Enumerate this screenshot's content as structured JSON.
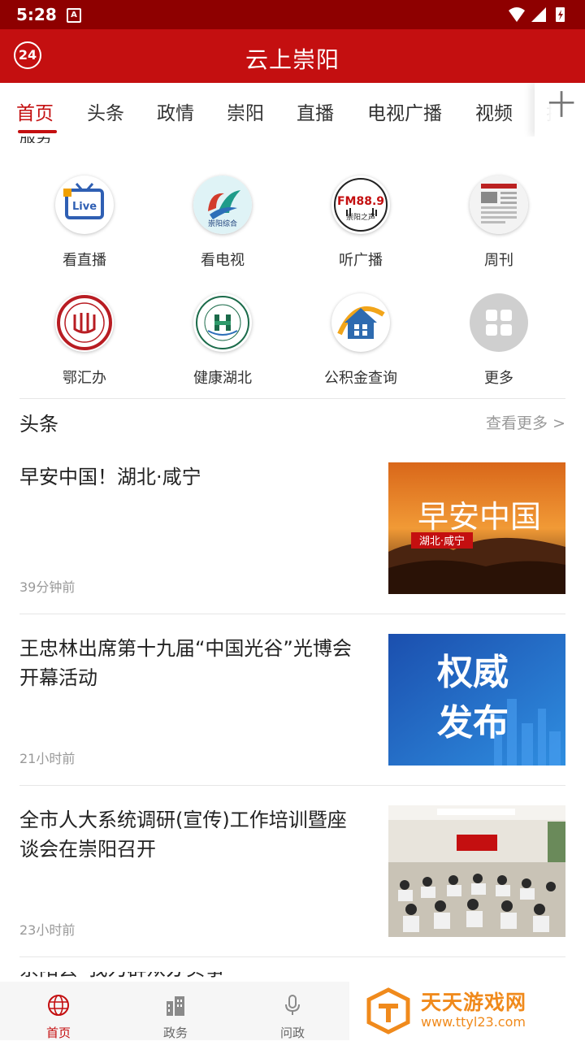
{
  "status_bar": {
    "time": "5:28",
    "notification_glyph": "A"
  },
  "header": {
    "badge": "24",
    "title": "云上崇阳"
  },
  "tabs": [
    {
      "label": "首页",
      "active": true
    },
    {
      "label": "头条"
    },
    {
      "label": "政情"
    },
    {
      "label": "崇阳"
    },
    {
      "label": "直播"
    },
    {
      "label": "电视广播"
    },
    {
      "label": "视频"
    },
    {
      "label": "扶贫"
    }
  ],
  "tab_more_glyph": "十",
  "clipped_heading": "服务",
  "shortcuts": [
    {
      "label": "看直播",
      "icon": "live-tv-icon",
      "icon_text": "Live"
    },
    {
      "label": "看电视",
      "icon": "tv-station-logo-icon",
      "icon_text": "崇阳综合"
    },
    {
      "label": "听广播",
      "icon": "radio-fm-icon",
      "icon_text": "FM88.9",
      "icon_subtext": "崇阳之声"
    },
    {
      "label": "周刊",
      "icon": "newspaper-icon"
    },
    {
      "label": "鄂汇办",
      "icon": "e-hui-ban-seal-icon"
    },
    {
      "label": "健康湖北",
      "icon": "health-hubei-seal-icon"
    },
    {
      "label": "公积金查询",
      "icon": "house-fund-icon"
    },
    {
      "label": "更多",
      "icon": "more-grid-icon"
    }
  ],
  "section": {
    "title": "头条",
    "more": "查看更多 >"
  },
  "news": [
    {
      "title": "早安中国！湖北·咸宁",
      "time": "39分钟前",
      "thumb_text": "早安中国",
      "thumb_sub": "湖北·咸宁"
    },
    {
      "title": "王忠林出席第十九届“中国光谷”光博会开幕活动",
      "time": "21小时前",
      "thumb_text_1": "权威",
      "thumb_text_2": "发布"
    },
    {
      "title": "全市人大系统调研(宣传)工作培训暨座谈会在崇阳召开",
      "time": "23小时前"
    }
  ],
  "partial_news_title": "崇阳县“我为群众办实事”",
  "bottom_nav": [
    {
      "label": "首页",
      "icon": "globe-icon",
      "active": true
    },
    {
      "label": "政务",
      "icon": "building-icon"
    },
    {
      "label": "问政",
      "icon": "microphone-icon"
    }
  ],
  "watermark": {
    "title": "天天游戏网",
    "url": "www.ttyl23.com"
  },
  "colors": {
    "brand_red": "#c40f10",
    "status_red": "#8e0000",
    "watermark_orange": "#f08a1c"
  }
}
